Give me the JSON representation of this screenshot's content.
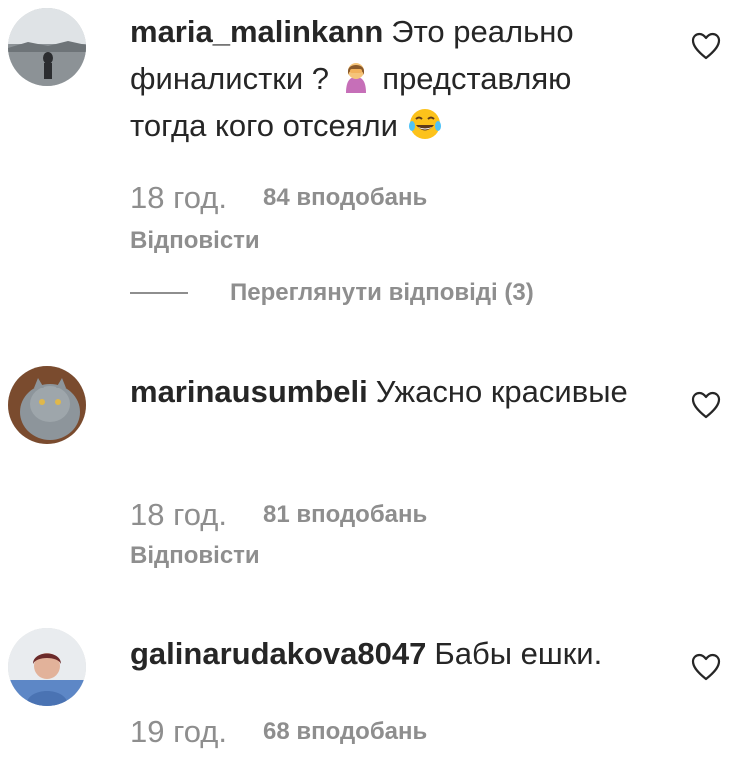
{
  "comments": [
    {
      "username": "maria_malinkann",
      "text_part1": "Это реально финалистки ?",
      "text_part2": "представляю тогда кого отсеяли",
      "emoji1": "woman-facepalming-icon",
      "emoji2": "face-with-tears-of-joy-icon",
      "time": "18 год.",
      "likes": "84 вподобань",
      "reply_label": "Відповісти",
      "view_replies_label": "Переглянути відповіді (3)"
    },
    {
      "username": "marinausumbeli",
      "text": "Ужасно красивые",
      "time": "18 год.",
      "likes": "81 вподобань",
      "reply_label": "Відповісти"
    },
    {
      "username": "galinarudakova8047",
      "text": "Бабы ешки.",
      "time": "19 год.",
      "likes": "68 вподобань"
    }
  ],
  "colors": {
    "text": "#262626",
    "secondary": "#8e8e8e",
    "background": "#ffffff"
  },
  "icons": {
    "like": "heart-outline-icon"
  }
}
